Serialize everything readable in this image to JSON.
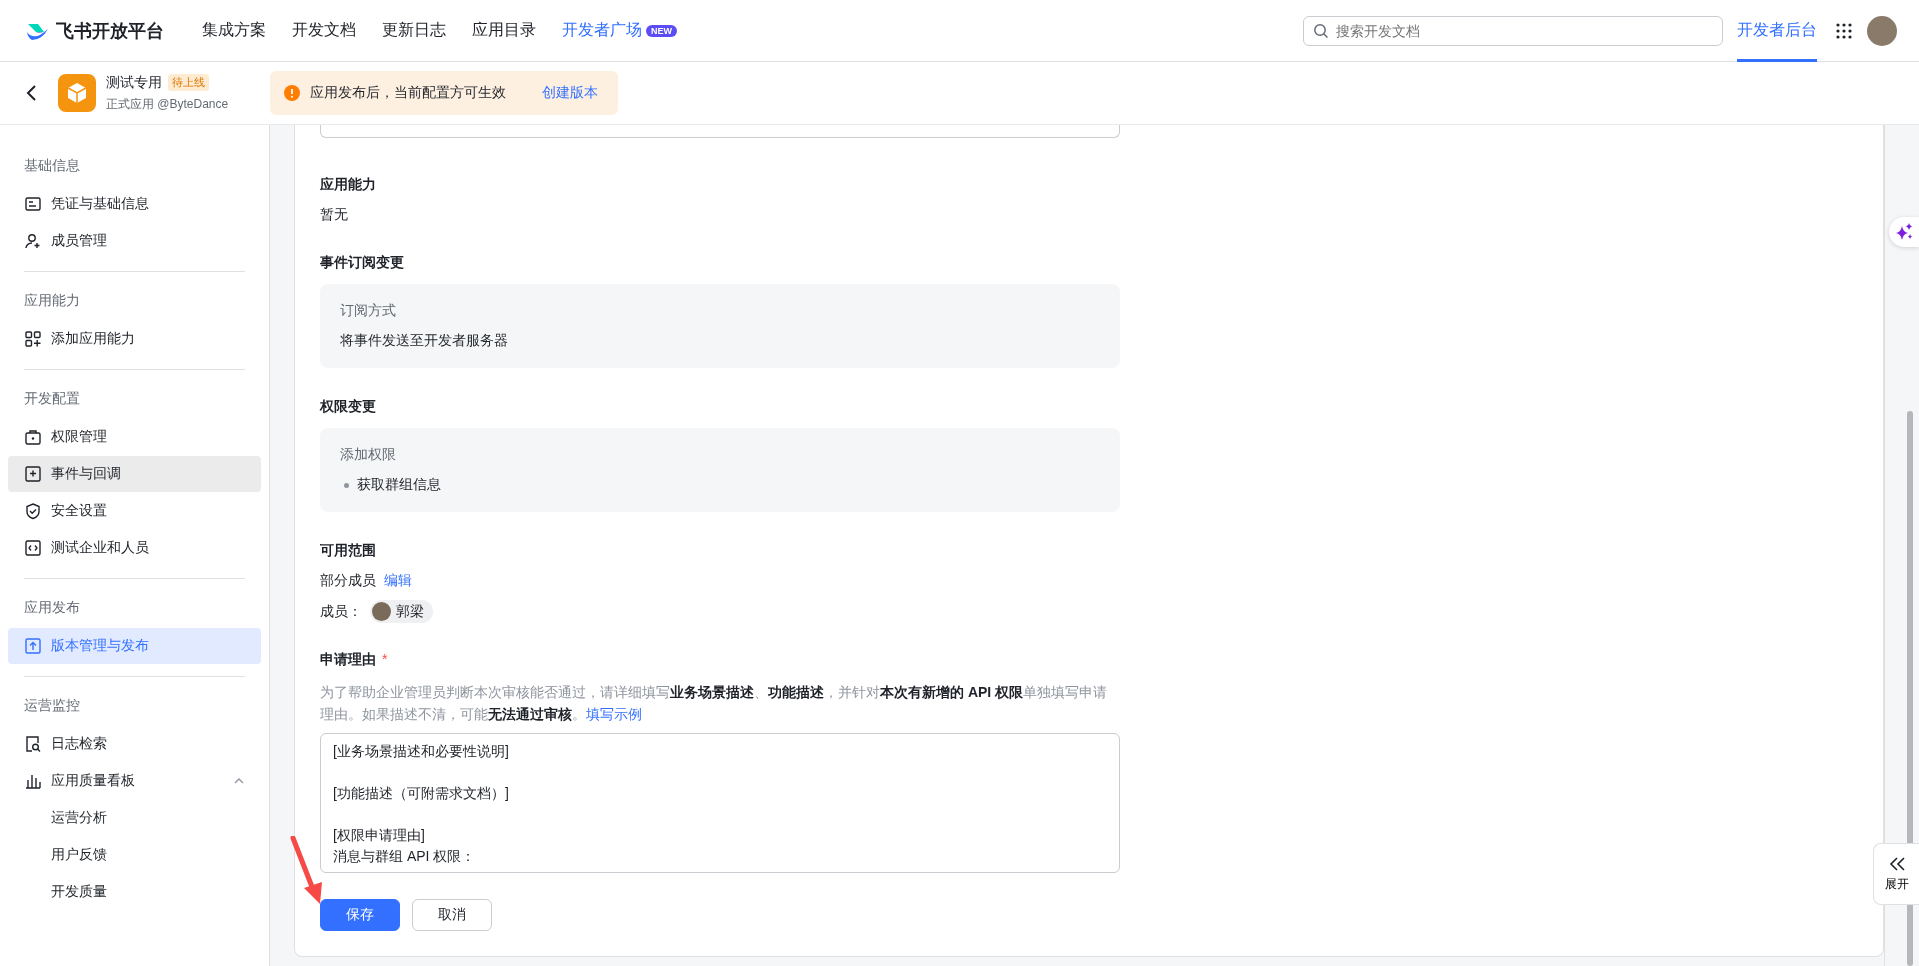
{
  "top_nav": {
    "logo_text": "飞书开放平台",
    "links": [
      {
        "label": "集成方案",
        "kind": "plain"
      },
      {
        "label": "开发文档",
        "kind": "plain"
      },
      {
        "label": "更新日志",
        "kind": "plain"
      },
      {
        "label": "应用目录",
        "kind": "plain"
      },
      {
        "label": "开发者广场",
        "kind": "featured",
        "badge": "NEW"
      }
    ],
    "search": {
      "placeholder": "搜索开发文档"
    },
    "console_link": {
      "label": "开发者后台",
      "selected": true
    }
  },
  "app_header": {
    "app_name": "测试专用",
    "status_badge": "待上线",
    "subtitle": "正式应用 @ByteDance",
    "notice": {
      "text": "应用发布后，当前配置方可生效",
      "action": "创建版本"
    }
  },
  "sidebar": {
    "sections": [
      {
        "title": "基础信息",
        "items": [
          {
            "label": "凭证与基础信息",
            "selected": false,
            "highlighted": false
          },
          {
            "label": "成员管理",
            "selected": false,
            "highlighted": false
          }
        ]
      },
      {
        "title": "应用能力",
        "items": [
          {
            "label": "添加应用能力",
            "selected": false,
            "highlighted": false
          }
        ]
      },
      {
        "title": "开发配置",
        "items": [
          {
            "label": "权限管理",
            "selected": false,
            "highlighted": false
          },
          {
            "label": "事件与回调",
            "selected": false,
            "highlighted": true
          },
          {
            "label": "安全设置",
            "selected": false,
            "highlighted": false
          },
          {
            "label": "测试企业和人员",
            "selected": false,
            "highlighted": false
          }
        ]
      },
      {
        "title": "应用发布",
        "items": [
          {
            "label": "版本管理与发布",
            "selected": true,
            "highlighted": false
          }
        ]
      },
      {
        "title": "运营监控",
        "items": [
          {
            "label": "日志检索",
            "selected": false,
            "highlighted": false
          },
          {
            "label": "应用质量看板",
            "selected": false,
            "highlighted": false,
            "expanded": true,
            "children": [
              {
                "label": "运营分析",
                "selected": false,
                "highlighted": false
              },
              {
                "label": "用户反馈",
                "selected": false,
                "highlighted": false
              },
              {
                "label": "开发质量",
                "selected": false,
                "highlighted": false
              }
            ]
          }
        ]
      }
    ]
  },
  "content": {
    "capability": {
      "title": "应用能力",
      "value": "暂无"
    },
    "event_change": {
      "title": "事件订阅变更",
      "label": "订阅方式",
      "value": "将事件发送至开发者服务器"
    },
    "permission_change": {
      "title": "权限变更",
      "label": "添加权限",
      "items": [
        "获取群组信息"
      ]
    },
    "scope": {
      "title": "可用范围",
      "value": "部分成员",
      "edit_link": "编辑",
      "members_label": "成员：",
      "members": [
        "郭梁"
      ]
    },
    "reason": {
      "title": "申请理由",
      "required_mark": "*",
      "description": "为了帮助企业管理员判断本次审核能否通过，请详细填写**业务场景描述**、**功能描述**，并针对**本次有新增的 API 权限**单独填写申请理由。如果描述不清，可能**无法通过审核**。",
      "example_link": "填写示例",
      "value": "[业务场景描述和必要性说明]\n\n[功能描述（可附需求文档）]\n\n[权限申请理由]\n消息与群组 API 权限："
    },
    "buttons": [
      {
        "label": "保存",
        "kind": "primary"
      },
      {
        "label": "取消",
        "kind": "default"
      }
    ]
  },
  "side_tools": {
    "expand_label": "展开"
  }
}
